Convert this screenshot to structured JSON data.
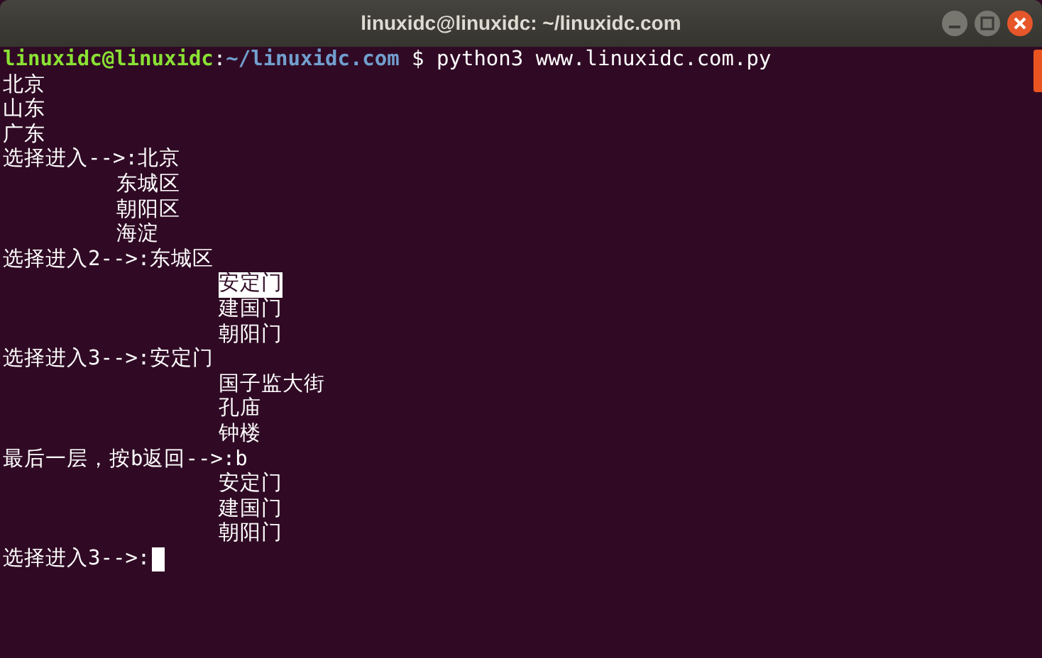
{
  "window": {
    "title": "linuxidc@linuxidc: ~/linuxidc.com"
  },
  "terminal": {
    "lines": [
      {
        "kind": "prompt",
        "user_host": "linuxidc@linuxidc",
        "separator": ":",
        "path": "~/linuxidc.com",
        "command": "$ python3 www.linuxidc.com.py"
      },
      {
        "kind": "output",
        "text": "北京"
      },
      {
        "kind": "output",
        "text": "山东"
      },
      {
        "kind": "output",
        "text": "广东"
      },
      {
        "kind": "output",
        "text": "选择进入-->:北京"
      },
      {
        "kind": "item1",
        "text": "东城区"
      },
      {
        "kind": "item1",
        "text": "朝阳区"
      },
      {
        "kind": "item1",
        "text": "海淀"
      },
      {
        "kind": "output",
        "text": "选择进入2-->:东城区"
      },
      {
        "kind": "item2",
        "text": "安定门",
        "highlighted": true
      },
      {
        "kind": "item2",
        "text": "建国门",
        "highlighted": false
      },
      {
        "kind": "item2",
        "text": "朝阳门",
        "highlighted": false
      },
      {
        "kind": "output",
        "text": "选择进入3-->:安定门"
      },
      {
        "kind": "item2",
        "text": "国子监大街",
        "highlighted": false
      },
      {
        "kind": "item2",
        "text": "孔庙",
        "highlighted": false
      },
      {
        "kind": "item2",
        "text": "钟楼",
        "highlighted": false
      },
      {
        "kind": "output",
        "text": "最后一层，按b返回-->:b"
      },
      {
        "kind": "item2",
        "text": "安定门",
        "highlighted": false
      },
      {
        "kind": "item2",
        "text": "建国门",
        "highlighted": false
      },
      {
        "kind": "item2",
        "text": "朝阳门",
        "highlighted": false
      },
      {
        "kind": "output",
        "text": "选择进入3-->:",
        "cursor": true
      }
    ]
  }
}
